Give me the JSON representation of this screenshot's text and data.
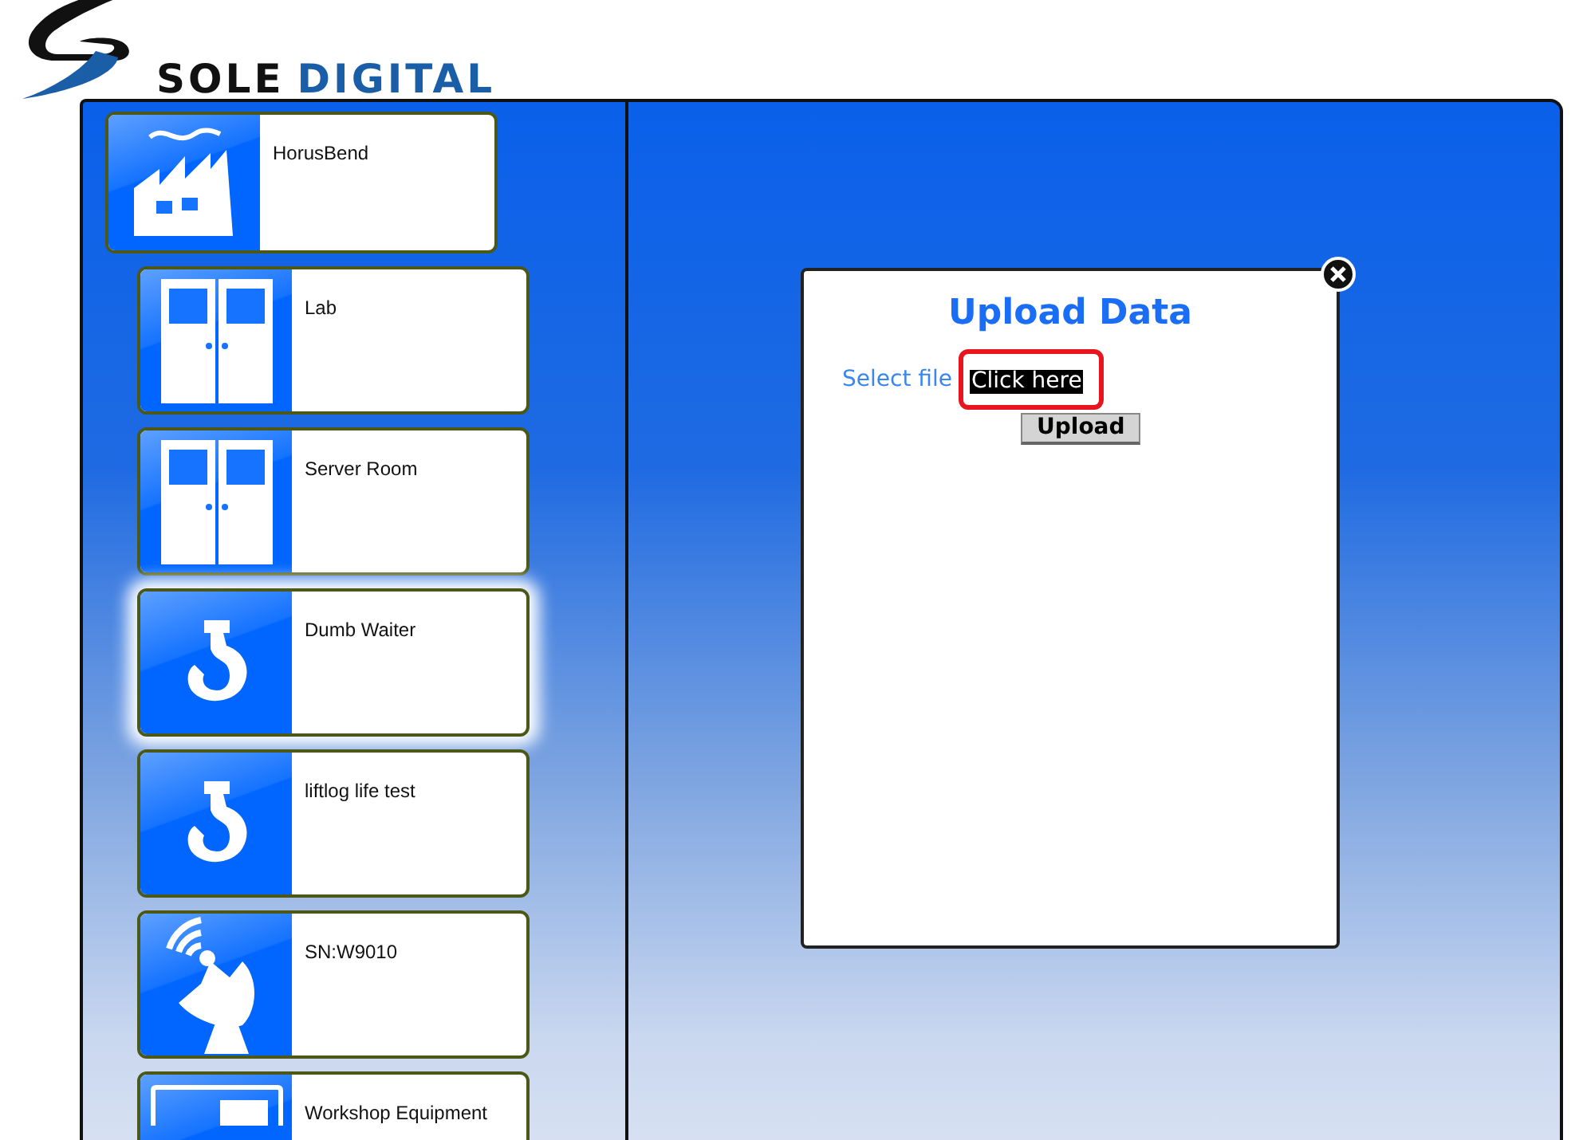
{
  "brand": {
    "word_1": "SOLE",
    "word_2": "DIGITAL"
  },
  "site": {
    "name": "HorusBend",
    "kind": "factory"
  },
  "locations": [
    {
      "name": "Lab",
      "kind": "door",
      "selected": false
    },
    {
      "name": "Server Room",
      "kind": "door",
      "selected": false
    },
    {
      "name": "Dumb Waiter",
      "kind": "hook",
      "selected": true
    },
    {
      "name": "liftlog life test",
      "kind": "hook",
      "selected": false
    },
    {
      "name": "SN:W9010",
      "kind": "dish",
      "selected": false
    },
    {
      "name": "Workshop Equipment",
      "kind": "monitor",
      "selected": false
    }
  ],
  "dialog": {
    "title": "Upload Data",
    "file_label": "Select file",
    "file_button": {
      "label": "Click here",
      "highlighted": true
    },
    "submit": "Upload"
  }
}
